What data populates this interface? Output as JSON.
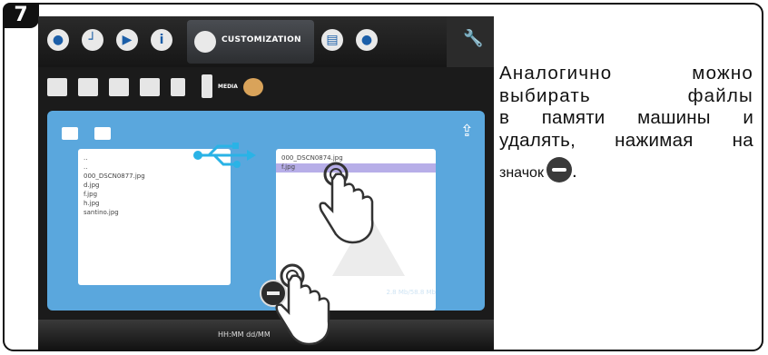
{
  "step_number": "7",
  "screen": {
    "top_tab_label": "CUSTOMIZATION",
    "sub_tab_label": "MEDIA",
    "left_files": [
      "..",
      "..",
      "000_DSCN0877.jpg",
      "d.jpg",
      "f.jpg",
      "h.jpg",
      "santino.jpg"
    ],
    "right_files": [
      "000_DSCN0874.jpg",
      "f.jpg"
    ],
    "right_selected_index": 1,
    "capacity": "2.8 Mb/58.8 Mb",
    "bottom_time": "HH:MM dd/MM"
  },
  "instruction": {
    "lines": [
      "Аналогично можно",
      "выбирать файлы",
      "в памяти машины и",
      "удалять, нажимая на"
    ],
    "last_word": "значок",
    "trailing": "."
  },
  "colors": {
    "panel_blue": "#5aa7dd",
    "selection_purple": "#b7aee8",
    "usb_cyan": "#2ab3e6"
  }
}
